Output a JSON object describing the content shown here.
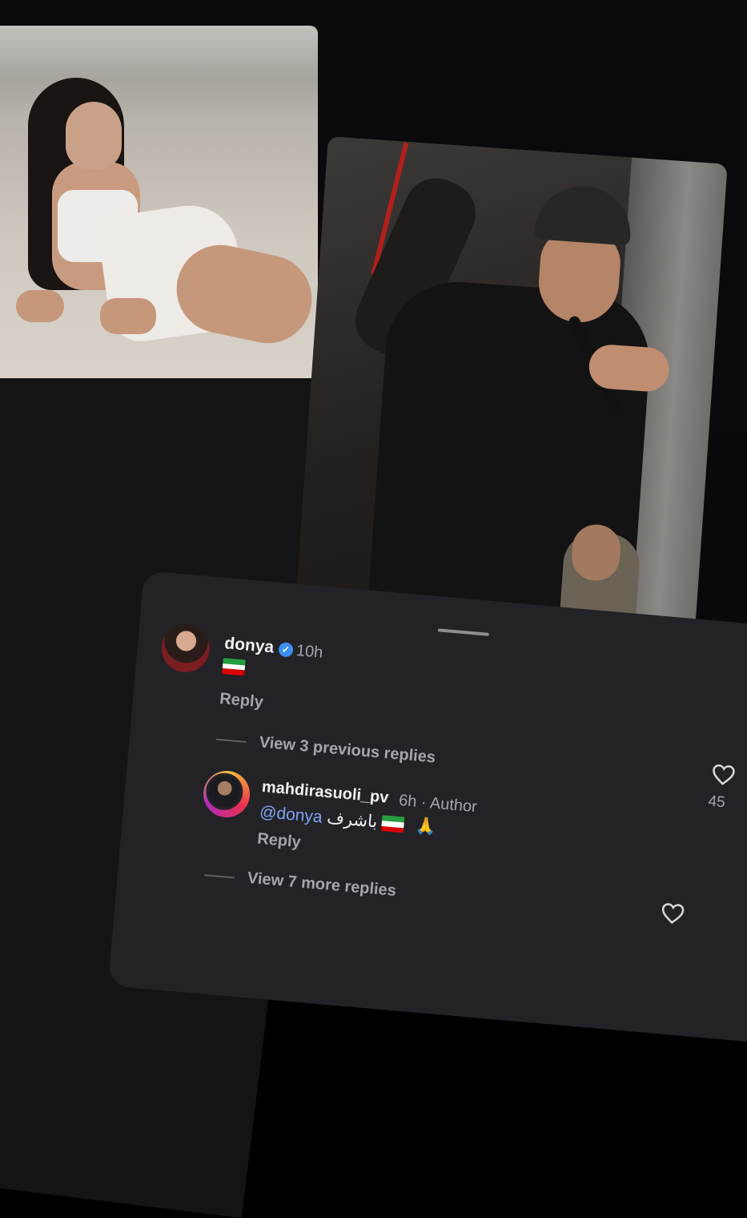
{
  "comments": [
    {
      "username": "donya",
      "verified": true,
      "time": "10h",
      "text_emoji": "flag-iran",
      "reply_label": "Reply",
      "view_replies": "View 3 previous replies"
    },
    {
      "username": "mahdirasuoli_pv",
      "time": "6h",
      "separator": "·",
      "author_label": "Author",
      "mention": "@donya",
      "text": "باشرف",
      "emojis": [
        "flag-iran",
        "folded-hands"
      ],
      "reply_label": "Reply",
      "view_replies": "View 7 more replies"
    }
  ],
  "likes": {
    "count": "45"
  },
  "icons": {
    "heart": "heart-outline-icon",
    "verified": "verified-badge-icon"
  },
  "colors": {
    "sheet": "#232327",
    "mention": "#7ea3f1",
    "verified": "#3b8ff0"
  }
}
